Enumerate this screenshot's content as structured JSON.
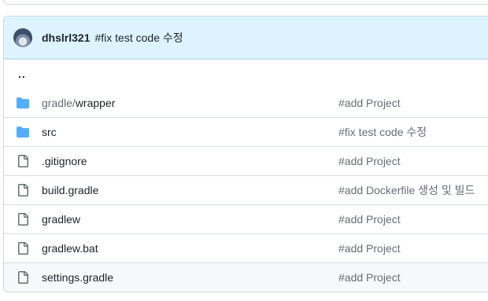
{
  "commit": {
    "author": "dhslrl321",
    "message": "#fix test code 수정"
  },
  "parent_link": "..",
  "files": [
    {
      "type": "folder",
      "prefix": "gradle/",
      "name": "wrapper",
      "message": "#add Project"
    },
    {
      "type": "folder",
      "prefix": "",
      "name": "src",
      "message": "#fix test code 수정"
    },
    {
      "type": "file",
      "prefix": "",
      "name": ".gitignore",
      "message": "#add Project"
    },
    {
      "type": "file",
      "prefix": "",
      "name": "build.gradle",
      "message": "#add Dockerfile 생성 및 빌드"
    },
    {
      "type": "file",
      "prefix": "",
      "name": "gradlew",
      "message": "#add Project"
    },
    {
      "type": "file",
      "prefix": "",
      "name": "gradlew.bat",
      "message": "#add Project"
    },
    {
      "type": "file",
      "prefix": "",
      "name": "settings.gradle",
      "message": "#add Project"
    }
  ],
  "colors": {
    "folder_icon": "#54aeff",
    "file_icon": "#656d76",
    "header_bg": "#ddf4ff",
    "hover_row": "#f6f8fa"
  }
}
